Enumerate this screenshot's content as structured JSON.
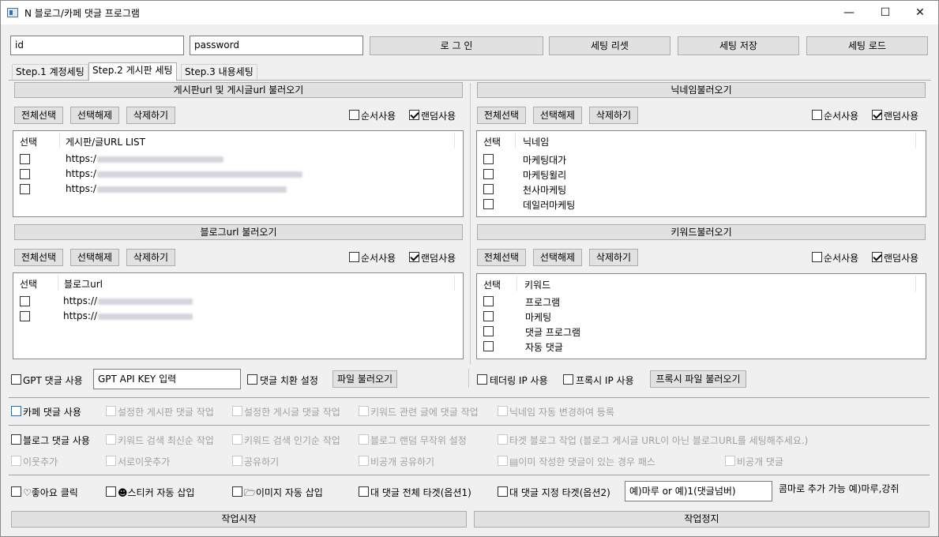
{
  "window": {
    "title": "N 블로그/카페 댓글 프로그램",
    "minimize": "—",
    "maximize": "☐",
    "close": "✕"
  },
  "login": {
    "id_value": "id",
    "password_value": "password",
    "login_label": "로 그 인",
    "reset_label": "세팅 리셋",
    "save_label": "세팅 저장",
    "load_label": "세팅 로드"
  },
  "tabs": [
    "Step.1 계정세팅",
    "Step.2 게시판 세팅",
    "Step.3 내용세팅"
  ],
  "common": {
    "select_all": "전체선택",
    "deselect": "선택해제",
    "delete": "삭제하기",
    "sequential": "순서사용",
    "random": "랜덤사용",
    "col_select": "선택"
  },
  "board_panel": {
    "header": "게시판url 및 게시글url 불러오기",
    "col_name": "게시판/글URL LIST",
    "rows": [
      "https:/",
      "https:/",
      "https:/"
    ]
  },
  "nick_panel": {
    "header": "닉네임불러오기",
    "col_name": "닉네임",
    "rows": [
      "마케팅대가",
      "마케팅윌리",
      "천사마케팅",
      "데일러마케팅"
    ]
  },
  "blog_panel": {
    "header": "블로그url 불러오기",
    "col_name": "블로그url",
    "rows": [
      "https://",
      "https://"
    ]
  },
  "keyword_panel": {
    "header": "키워드불러오기",
    "col_name": "키워드",
    "rows": [
      "프로그램",
      "마케팅",
      "댓글 프로그램",
      "자동 댓글"
    ]
  },
  "options": {
    "gpt_use": "GPT 댓글 사용",
    "gpt_key_value": "GPT API KEY 입력",
    "replace_setting": "댓글 치환 설정",
    "file_load": "파일 불러오기",
    "tethering": "테더링 IP 사용",
    "proxy": "프록시 IP 사용",
    "proxy_file_load": "프록시 파일 불러오기",
    "cafe_use": "카페 댓글 사용",
    "cafe_opt1": "설정한 게시판 댓글 작업",
    "cafe_opt2": "설정한 게시글 댓글 작업",
    "cafe_opt3": "키워드 관련 글에 댓글 작업",
    "cafe_opt4": "닉네임 자동 변경하여 등록",
    "blog_use": "블로그 댓글 사용",
    "blog_opt1": "키워드 검색 최신순 작업",
    "blog_opt2": "키워드 검색 인기순 작업",
    "blog_opt3": "블로그 랜덤 무작위 설정",
    "blog_opt4": "타겟 블로그 작업 (블로그 게시글 URL이 아닌 블로그URL를 세팅해주세요.)",
    "neighbor_add": "이웃추가",
    "mutual_add": "서로이웃추가",
    "share": "공유하기",
    "private_share": "비공개 공유하기",
    "skip_commented": "▤이미 작성한 댓글이 있는 경우 패스",
    "private_comment": "비공개 댓글",
    "like_click": "♡좋아요 클릭",
    "sticker_insert": "☻스티커 자동 삽입",
    "image_insert": "🗁이미지 자동 삽입",
    "reply_all": "대 댓글 전체 타겟(옵션1)",
    "reply_target": "대 댓글 지정 타겟(옵션2)",
    "reply_target_value": "예)마루 or 예)1(댓글넘버)",
    "reply_hint": "콤마로 추가 가능 예)마루,강쥐"
  },
  "actions": {
    "start": "작업시작",
    "stop": "작업정지"
  }
}
